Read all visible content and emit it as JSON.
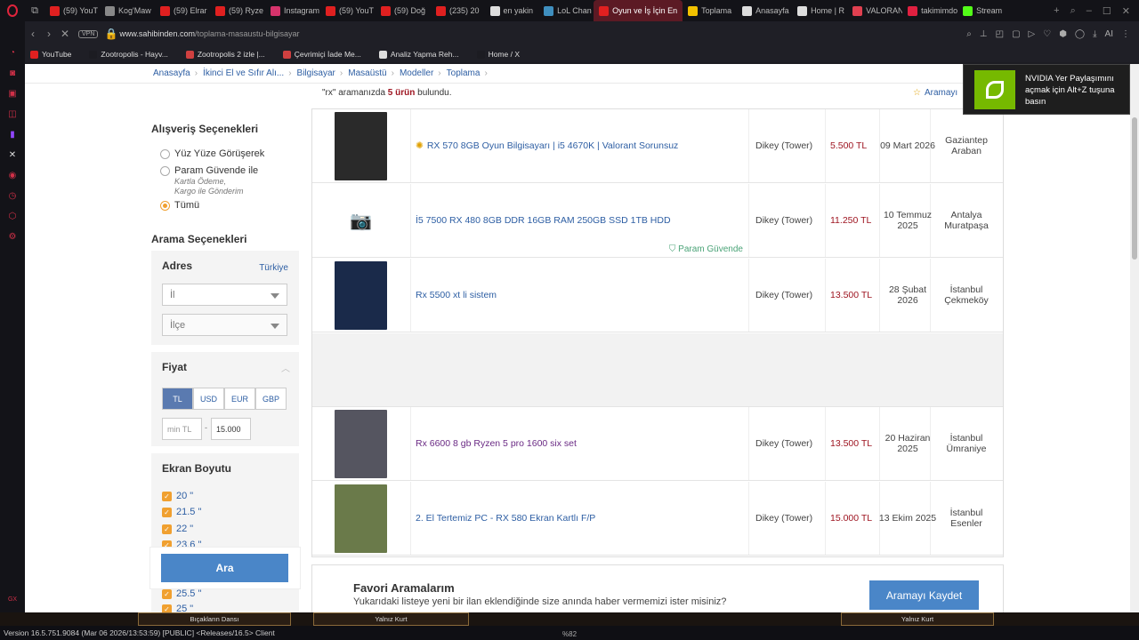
{
  "browser": {
    "tabs": [
      {
        "label": "(59) YouT",
        "color": "#e02020"
      },
      {
        "label": "Kog'Maw",
        "color": "#888888"
      },
      {
        "label": "(59) Elrar",
        "color": "#e02020"
      },
      {
        "label": "(59) Ryze",
        "color": "#e02020"
      },
      {
        "label": "Instagram",
        "color": "#d6336c"
      },
      {
        "label": "(59) YouT",
        "color": "#e02020"
      },
      {
        "label": "(59) Doğ",
        "color": "#e02020"
      },
      {
        "label": "(235) 20",
        "color": "#e02020"
      },
      {
        "label": "en yakin",
        "color": "#dddddd"
      },
      {
        "label": "LoL Chan",
        "color": "#3f8fbf"
      },
      {
        "label": "Oyun ve İş İçin En",
        "color": "#e02020",
        "active": true
      },
      {
        "label": "Toplama",
        "color": "#f2c200"
      },
      {
        "label": "Anasayfa",
        "color": "#dddddd"
      },
      {
        "label": "Home | R",
        "color": "#dddddd"
      },
      {
        "label": "VALORAN",
        "color": "#e04050"
      },
      {
        "label": "takimimdo",
        "color": "#e02040"
      },
      {
        "label": "Stream",
        "color": "#53fc18"
      }
    ],
    "url_host": "www.sahibinden.com",
    "url_path": "/toplama-masaustu-bilgisayar",
    "vpn_label": "VPN",
    "ai_label": "AI",
    "bookmarks": [
      {
        "label": "YouTube",
        "color": "#e02020"
      },
      {
        "label": "Zootropolis - Hayv...",
        "color": "#1c1c22"
      },
      {
        "label": "Zootropolis 2 izle |...",
        "color": "#d04040"
      },
      {
        "label": "Çevrimiçi İade Me...",
        "color": "#d04040"
      },
      {
        "label": "Analiz Yapma Reh...",
        "color": "#dddddd"
      },
      {
        "label": "Home / X",
        "color": "#1c1c22"
      }
    ]
  },
  "breadcrumbs": [
    "Anasayfa",
    "İkinci El ve Sıfır Alı...",
    "Bilgisayar",
    "Masaüstü",
    "Modeller",
    "Toplama"
  ],
  "summary": {
    "pre": "\"rx\" aramanızda ",
    "count": "5 ürün",
    "post": " bulundu."
  },
  "save_search_top": "Aramayı",
  "shopping": {
    "title": "Alışveriş Seçenekleri",
    "options": [
      "Yüz Yüze Görüşerek",
      "Param Güvende ile",
      "Tümü"
    ],
    "note1": "Kartla Ödeme,",
    "note2": "Kargo ile Gönderim"
  },
  "search_options_title": "Arama Seçenekleri",
  "address": {
    "title": "Adres",
    "country": "Türkiye",
    "il": "İl",
    "ilce": "İlçe"
  },
  "price": {
    "title": "Fiyat",
    "currencies": [
      "TL",
      "USD",
      "EUR",
      "GBP"
    ],
    "min_placeholder": "min TL",
    "dash": "-",
    "max": "15.000"
  },
  "screen": {
    "title": "Ekran Boyutu",
    "sizes": [
      "20 \"",
      "21.5 \"",
      "22 \"",
      "23.6 \"",
      "25.5 \"",
      "25 \""
    ]
  },
  "search_button": "Ara",
  "listings": [
    {
      "title": "RX 570 8GB Oyun Bilgisayarı | i5 4670K | Valorant Sorunsuz",
      "featured": true,
      "model": "Dikey (Tower)",
      "price": "5.500 TL",
      "date": "09 Mart 2026",
      "loc": "Gaziantep Araban",
      "thumb": "#2a2a2a"
    },
    {
      "title": "İ5 7500 RX 480 8GB DDR 16GB RAM 250GB SSD 1TB HDD",
      "model": "Dikey (Tower)",
      "price": "11.250 TL",
      "date": "10 Temmuz 2025",
      "loc": "Antalya Muratpaşa",
      "badge": "Param Güvende",
      "thumb": "none"
    },
    {
      "title": "Rx 5500 xt li sistem",
      "model": "Dikey (Tower)",
      "price": "13.500 TL",
      "date": "28 Şubat 2026",
      "loc": "İstanbul Çekmeköy",
      "thumb": "#1a2a4a"
    },
    {
      "title": "Rx 6600 8 gb Ryzen 5 pro 1600 six set",
      "visited": true,
      "model": "Dikey (Tower)",
      "price": "13.500 TL",
      "date": "20 Haziran 2025",
      "loc": "İstanbul Ümraniye",
      "thumb": "#555560"
    },
    {
      "title": "2. El Tertemiz PC - RX 580 Ekran Kartlı F/P",
      "model": "Dikey (Tower)",
      "price": "15.000 TL",
      "date": "13 Ekim 2025",
      "loc": "İstanbul Esenler",
      "thumb": "#6a7a4a"
    }
  ],
  "favorites": {
    "title": "Favori Aramalarım",
    "desc": "Yukarıdaki listeye yeni bir ilan eklendiğinde size anında haber vermemizi ister misiniz?",
    "button": "Aramayı Kaydet"
  },
  "nvidia": {
    "text": "NVIDIA Yer Paylaşımını açmak için Alt+Z tuşuna basın"
  },
  "game_bar": {
    "slot1": "Bıçakların Dansı",
    "slot2": "Yalnız Kurt",
    "slot3": "Yalnız Kurt",
    "fps": "%82"
  },
  "status": "Version 16.5.751.9084 (Mar 06 2026/13:53:59) [PUBLIC] <Releases/16.5> Client"
}
